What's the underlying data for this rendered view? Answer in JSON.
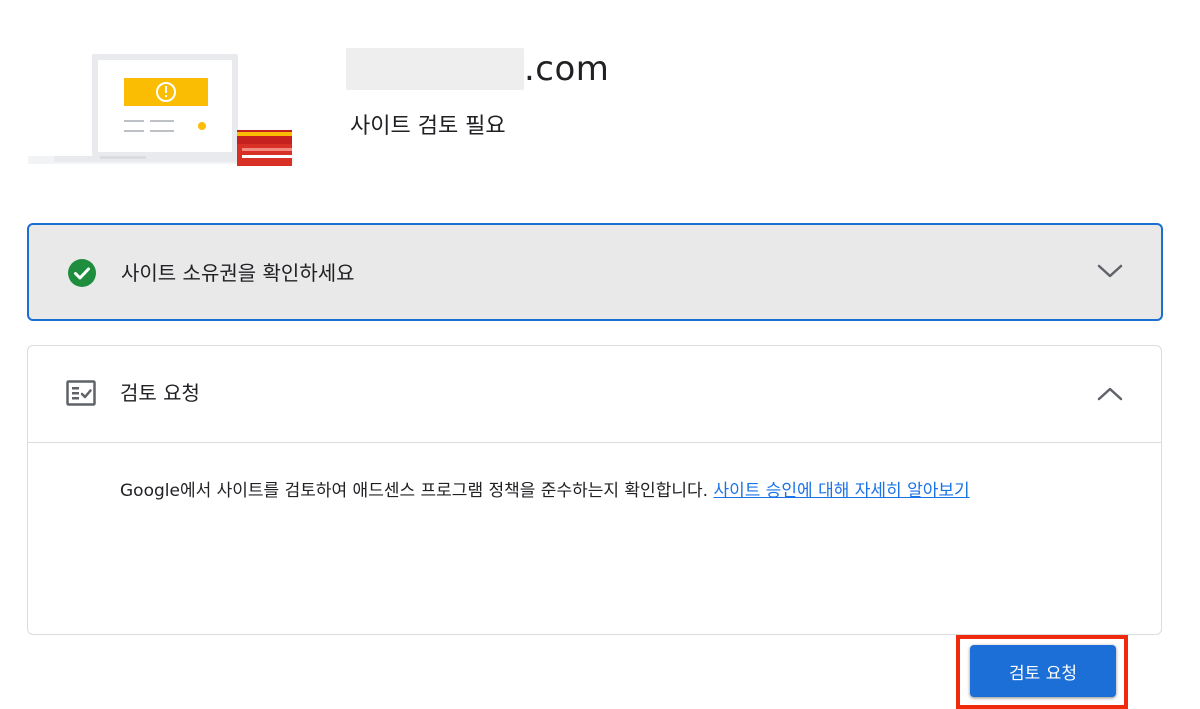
{
  "header": {
    "domain_suffix": ".com",
    "site_status": "사이트 검토 필요"
  },
  "panels": {
    "verify": {
      "title": "사이트 소유권을 확인하세요",
      "status_icon": "check-circle-icon",
      "expanded": false
    },
    "review": {
      "title": "검토 요청",
      "icon": "checklist-icon",
      "expanded": true,
      "description": "Google에서 사이트를 검토하여 애드센스 프로그램 정책을 준수하는지 확인합니다.",
      "learn_more_label": "사이트 승인에 대해 자세히 알아보기",
      "button_label": "검토 요청"
    }
  },
  "colors": {
    "accent": "#1a73e8",
    "highlight_border": "#f02a0c",
    "success": "#1e8e3e",
    "warning": "#fbbc04"
  }
}
